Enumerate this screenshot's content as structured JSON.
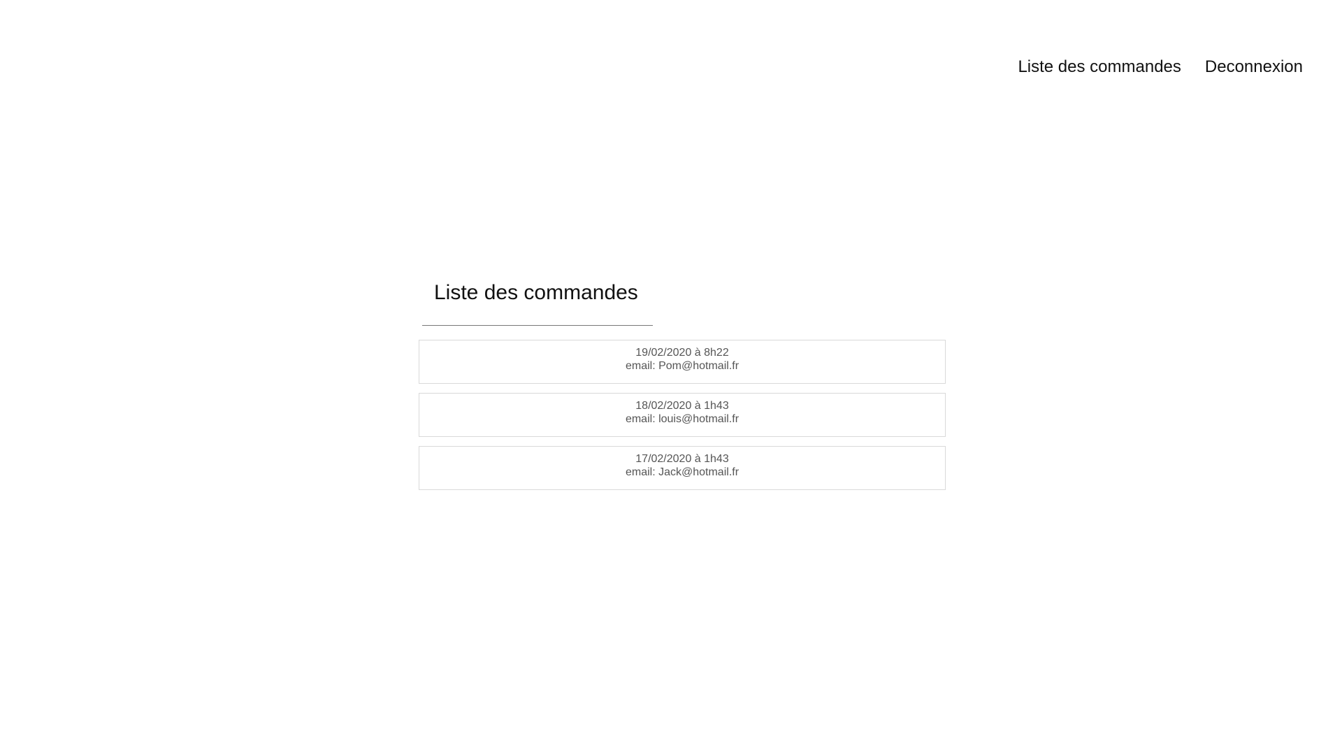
{
  "nav": {
    "orders_link": "Liste des commandes",
    "logout_link": "Deconnexion"
  },
  "main": {
    "title": "Liste des commandes",
    "orders": [
      {
        "date": "19/02/2020 à 8h22",
        "email": "email: Pom@hotmail.fr"
      },
      {
        "date": "18/02/2020 à 1h43",
        "email": "email: louis@hotmail.fr"
      },
      {
        "date": "17/02/2020 à 1h43",
        "email": "email: Jack@hotmail.fr"
      }
    ]
  }
}
